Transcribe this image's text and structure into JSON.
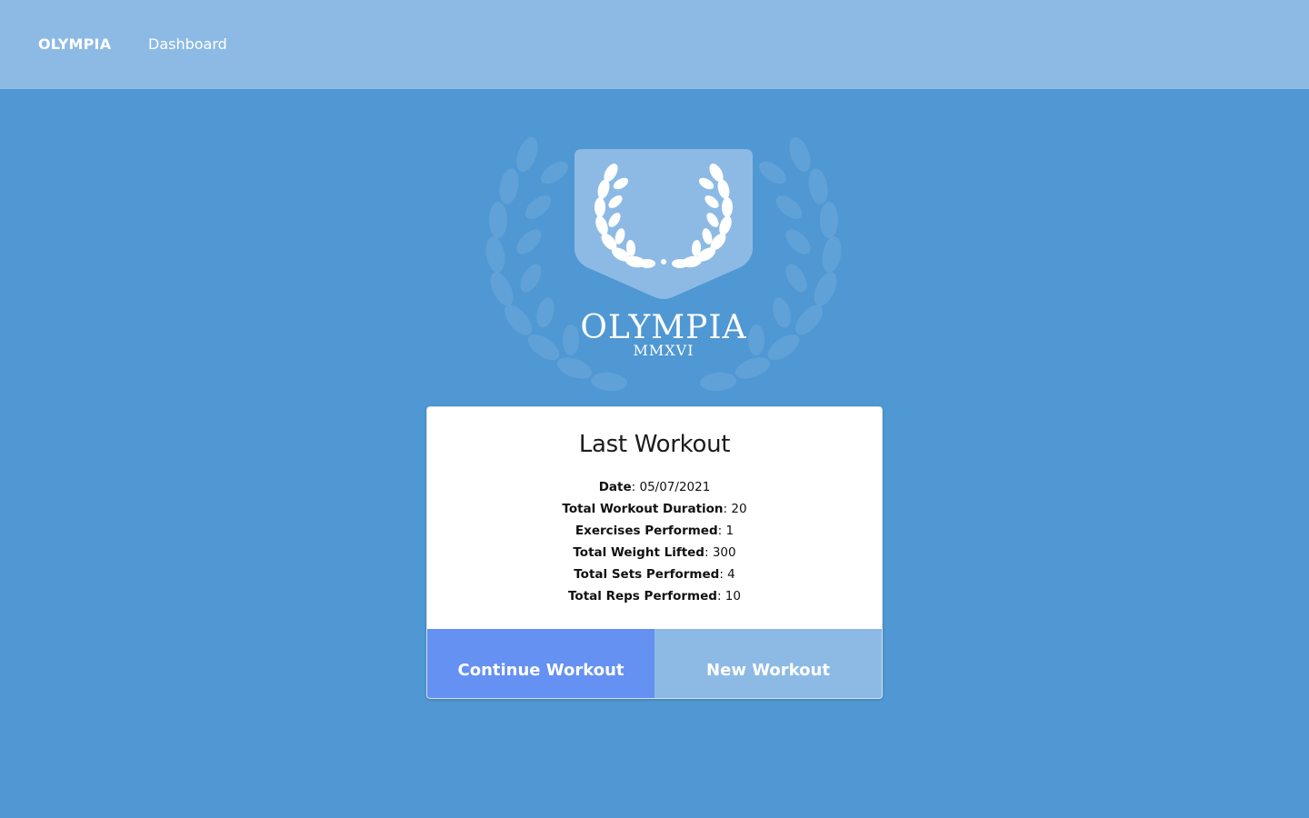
{
  "header": {
    "brand": "OLYMPIA",
    "nav": [
      {
        "label": "Dashboard"
      }
    ]
  },
  "logo": {
    "name": "OLYMPIA",
    "subtitle": "MMXVI"
  },
  "card": {
    "title": "Last Workout",
    "stats": [
      {
        "label": "Date",
        "value": "05/07/2021"
      },
      {
        "label": "Total Workout Duration",
        "value": "20"
      },
      {
        "label": "Exercises Performed",
        "value": "1"
      },
      {
        "label": "Total Weight Lifted",
        "value": "300"
      },
      {
        "label": "Total Sets Performed",
        "value": "4"
      },
      {
        "label": "Total Reps Performed",
        "value": "10"
      }
    ],
    "buttons": {
      "continue": "Continue Workout",
      "new": "New Workout"
    }
  },
  "colors": {
    "background": "#4f98d3",
    "header": "#8dbae5",
    "continue_button": "#6491f2",
    "new_button": "#8dbae5",
    "card": "#ffffff"
  }
}
